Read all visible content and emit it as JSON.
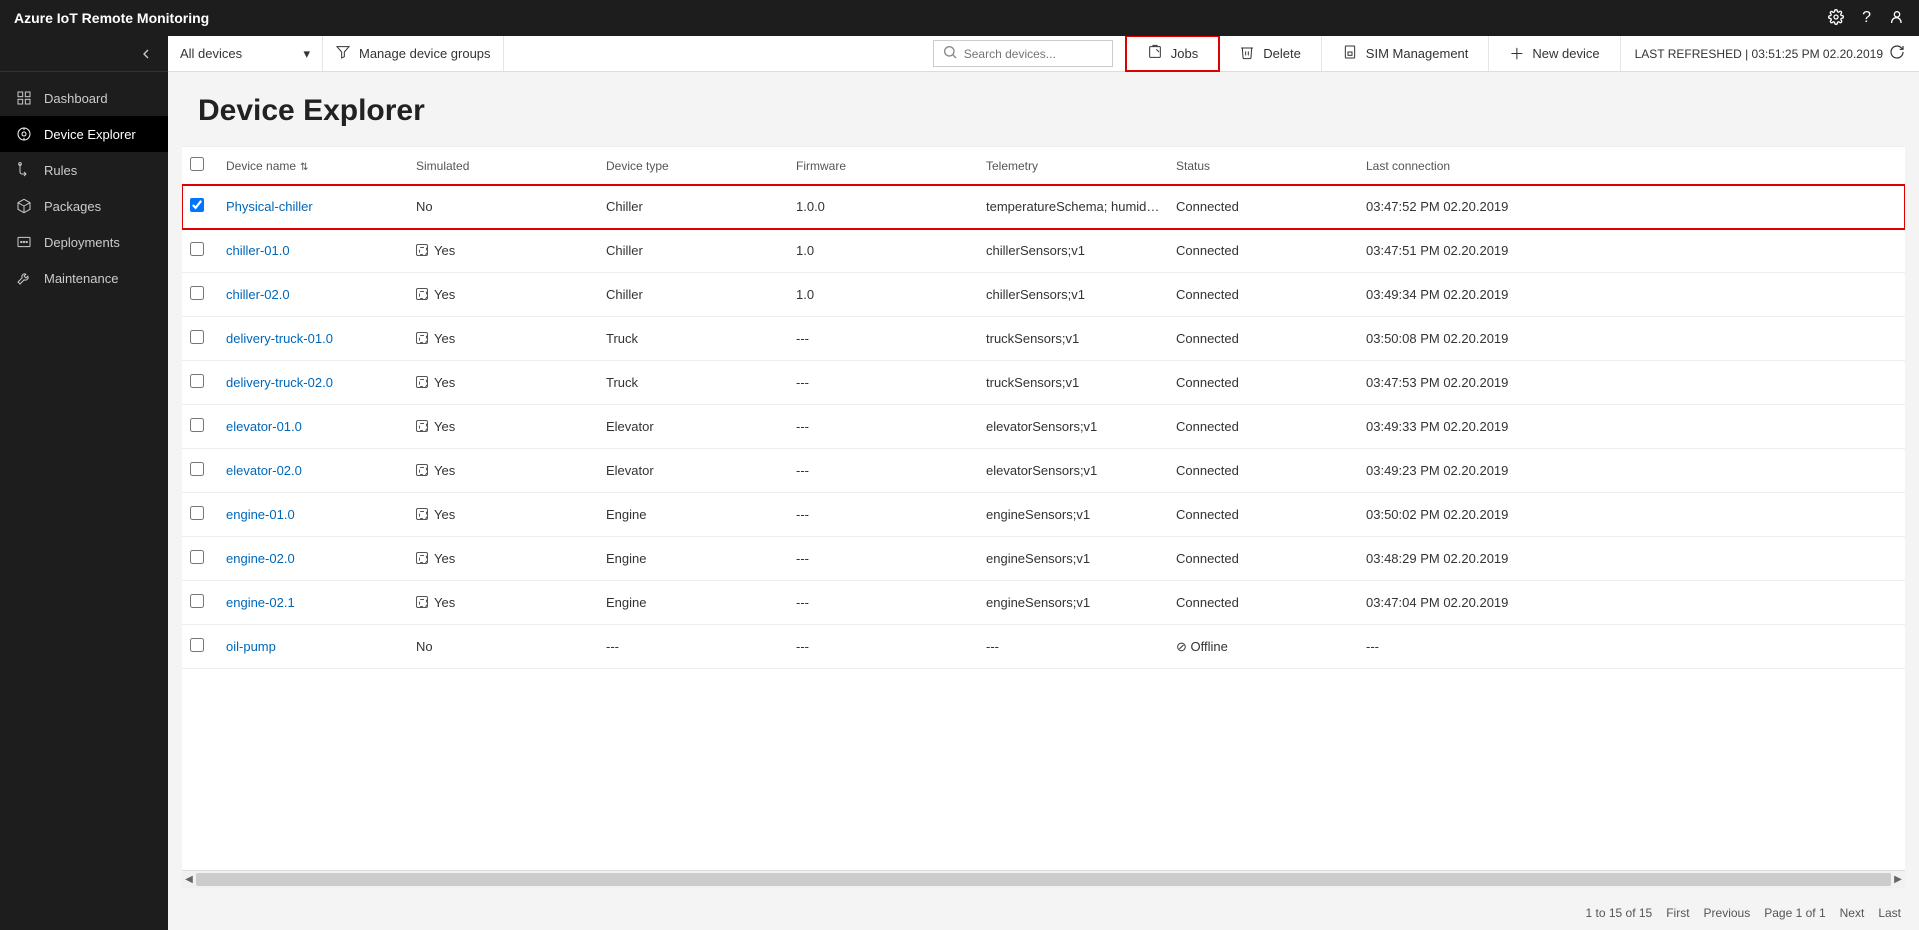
{
  "app": {
    "title": "Azure IoT Remote Monitoring"
  },
  "sidebar": {
    "items": [
      {
        "icon": "dashboard",
        "label": "Dashboard"
      },
      {
        "icon": "devices",
        "label": "Device Explorer"
      },
      {
        "icon": "rules",
        "label": "Rules"
      },
      {
        "icon": "packages",
        "label": "Packages"
      },
      {
        "icon": "deploy",
        "label": "Deployments"
      },
      {
        "icon": "maint",
        "label": "Maintenance"
      }
    ],
    "activeIndex": 1
  },
  "toolbar": {
    "filter": "All devices",
    "manage": "Manage device groups",
    "searchPlaceholder": "Search devices...",
    "jobs": "Jobs",
    "delete": "Delete",
    "sim": "SIM Management",
    "newdev": "New device",
    "last": "LAST REFRESHED | 03:51:25 PM 02.20.2019"
  },
  "page": {
    "title": "Device Explorer"
  },
  "columns": {
    "c0": "",
    "c1": "Device name",
    "c2": "Simulated",
    "c3": "Device type",
    "c4": "Firmware",
    "c5": "Telemetry",
    "c6": "Status",
    "c7": "Last connection"
  },
  "rows": [
    {
      "checked": true,
      "link": "Physical-chiller",
      "simIcon": false,
      "sim": "No",
      "type": "Chiller",
      "fw": "1.0.0",
      "tele": "temperatureSchema; humiditySche...",
      "status": "Connected",
      "last": "03:47:52 PM 02.20.2019",
      "hl": true
    },
    {
      "checked": false,
      "link": "chiller-01.0",
      "simIcon": true,
      "sim": "Yes",
      "type": "Chiller",
      "fw": "1.0",
      "tele": "chillerSensors;v1",
      "status": "Connected",
      "last": "03:47:51 PM 02.20.2019"
    },
    {
      "checked": false,
      "link": "chiller-02.0",
      "simIcon": true,
      "sim": "Yes",
      "type": "Chiller",
      "fw": "1.0",
      "tele": "chillerSensors;v1",
      "status": "Connected",
      "last": "03:49:34 PM 02.20.2019"
    },
    {
      "checked": false,
      "link": "delivery-truck-01.0",
      "simIcon": true,
      "sim": "Yes",
      "type": "Truck",
      "fw": "---",
      "tele": "truckSensors;v1",
      "status": "Connected",
      "last": "03:50:08 PM 02.20.2019"
    },
    {
      "checked": false,
      "link": "delivery-truck-02.0",
      "simIcon": true,
      "sim": "Yes",
      "type": "Truck",
      "fw": "---",
      "tele": "truckSensors;v1",
      "status": "Connected",
      "last": "03:47:53 PM 02.20.2019"
    },
    {
      "checked": false,
      "link": "elevator-01.0",
      "simIcon": true,
      "sim": "Yes",
      "type": "Elevator",
      "fw": "---",
      "tele": "elevatorSensors;v1",
      "status": "Connected",
      "last": "03:49:33 PM 02.20.2019"
    },
    {
      "checked": false,
      "link": "elevator-02.0",
      "simIcon": true,
      "sim": "Yes",
      "type": "Elevator",
      "fw": "---",
      "tele": "elevatorSensors;v1",
      "status": "Connected",
      "last": "03:49:23 PM 02.20.2019"
    },
    {
      "checked": false,
      "link": "engine-01.0",
      "simIcon": true,
      "sim": "Yes",
      "type": "Engine",
      "fw": "---",
      "tele": "engineSensors;v1",
      "status": "Connected",
      "last": "03:50:02 PM 02.20.2019"
    },
    {
      "checked": false,
      "link": "engine-02.0",
      "simIcon": true,
      "sim": "Yes",
      "type": "Engine",
      "fw": "---",
      "tele": "engineSensors;v1",
      "status": "Connected",
      "last": "03:48:29 PM 02.20.2019"
    },
    {
      "checked": false,
      "link": "engine-02.1",
      "simIcon": true,
      "sim": "Yes",
      "type": "Engine",
      "fw": "---",
      "tele": "engineSensors;v1",
      "status": "Connected",
      "last": "03:47:04 PM 02.20.2019"
    },
    {
      "checked": false,
      "link": "oil-pump",
      "simIcon": false,
      "sim": "No",
      "type": "---",
      "fw": "---",
      "tele": "---",
      "status": "Offline",
      "statusOff": true,
      "last": "---"
    }
  ],
  "pager": {
    "range": "1 to 15 of 15",
    "first": "First",
    "prev": "Previous",
    "page": "Page 1 of 1",
    "next": "Next",
    "last": "Last"
  }
}
